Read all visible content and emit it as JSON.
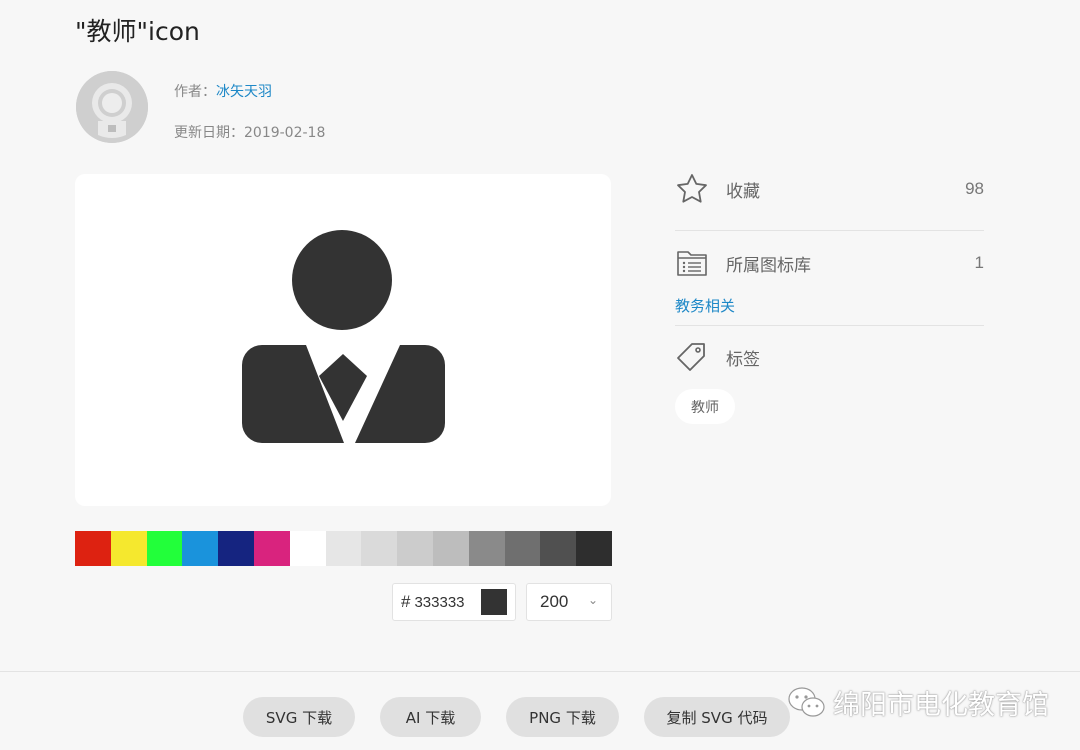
{
  "page": {
    "title": "\"教师\"icon"
  },
  "meta": {
    "author_label": "作者：",
    "author_name": "冰矢天羽",
    "date_label": "更新日期：",
    "date_value": "2019-02-18"
  },
  "icons": {
    "preview": "teacher-person-icon",
    "avatar": "astronaut-avatar-icon",
    "favorite": "star-icon",
    "library": "folder-list-icon",
    "tag": "tag-icon",
    "size_dropdown": "chevron-down-icon",
    "watermark": "wechat-icon"
  },
  "palette": {
    "colors": [
      "#dd2211",
      "#f5e82e",
      "#22ff3a",
      "#1a93dc",
      "#152480",
      "#d9237e",
      "#ffffff",
      "#e6e6e6",
      "#dadada",
      "#cccccc",
      "#bdbdbd",
      "#8a8a8a",
      "#6f6f6f",
      "#505050",
      "#2e2e2e"
    ]
  },
  "color_input": {
    "hash": "#",
    "value": "333333",
    "chip_color": "#333333"
  },
  "size_select": {
    "value": "200",
    "chevron": "⌄"
  },
  "sidebar": {
    "favorite_label": "收藏",
    "favorite_count": "98",
    "library_label": "所属图标库",
    "library_count": "1",
    "library_name": "教务相关",
    "tags_label": "标签",
    "tags": [
      "教师"
    ]
  },
  "buttons": {
    "svg_download": "SVG 下载",
    "ai_download": "AI 下载",
    "png_download": "PNG 下载",
    "copy_svg": "复制 SVG 代码"
  },
  "watermark": {
    "text": "绵阳市电化教育馆"
  },
  "colors": {
    "accent": "#1e88c7",
    "icon_fill": "#333333"
  }
}
